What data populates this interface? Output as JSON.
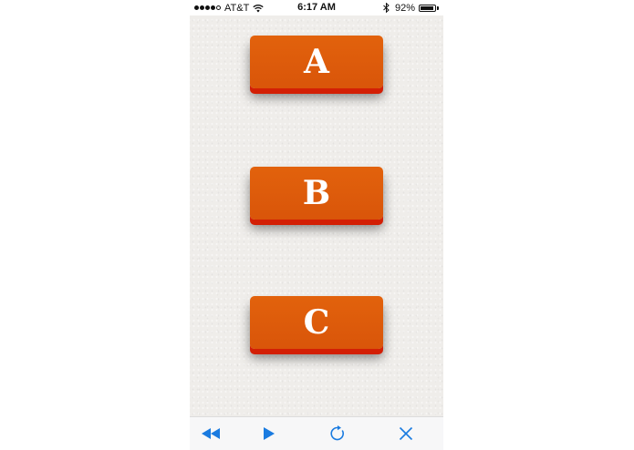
{
  "status_bar": {
    "carrier": "AT&T",
    "time": "6:17 AM",
    "battery_percent": "92%",
    "battery_level": 0.92,
    "signal_bars_filled": 4,
    "signal_bars_total": 5
  },
  "keys": [
    {
      "label": "A"
    },
    {
      "label": "B"
    },
    {
      "label": "C"
    }
  ],
  "toolbar": {
    "buttons": [
      "rewind-icon",
      "play-icon",
      "reload-icon",
      "close-icon"
    ]
  },
  "colors": {
    "key_face": "#dd5a0a",
    "key_edge": "#d31f05",
    "toolbar_icon": "#1a7be0",
    "background": "#efedea"
  }
}
